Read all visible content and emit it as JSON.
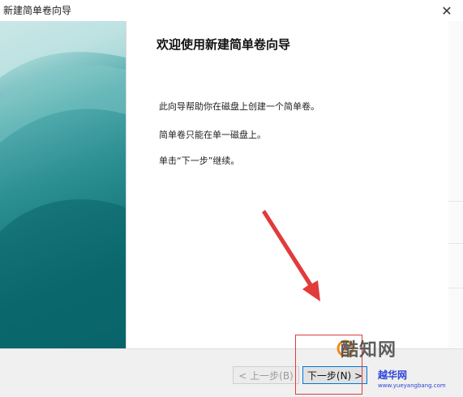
{
  "window": {
    "title": "新建简单卷向导",
    "close_glyph": "✕"
  },
  "content": {
    "heading": "欢迎使用新建简单卷向导",
    "paragraphs": [
      "此向导帮助你在磁盘上创建一个简单卷。",
      "简单卷只能在单一磁盘上。",
      "单击“下一步”继续。"
    ]
  },
  "buttons": {
    "back_label": "< 上一步(B)",
    "next_label": "下一步(N) >"
  },
  "watermark": {
    "brand": "酷知网",
    "site_name": "越华网",
    "site_url": "www.yueyangbang.com"
  },
  "colors": {
    "annotation_red": "#e23b3b",
    "panel_teal": "#1c7f82",
    "focus_blue": "#0078d7"
  },
  "icons": {
    "close": "close-icon",
    "arrow": "red-arrow-annotation",
    "watermark_logo": "watermark-logo-icon"
  }
}
